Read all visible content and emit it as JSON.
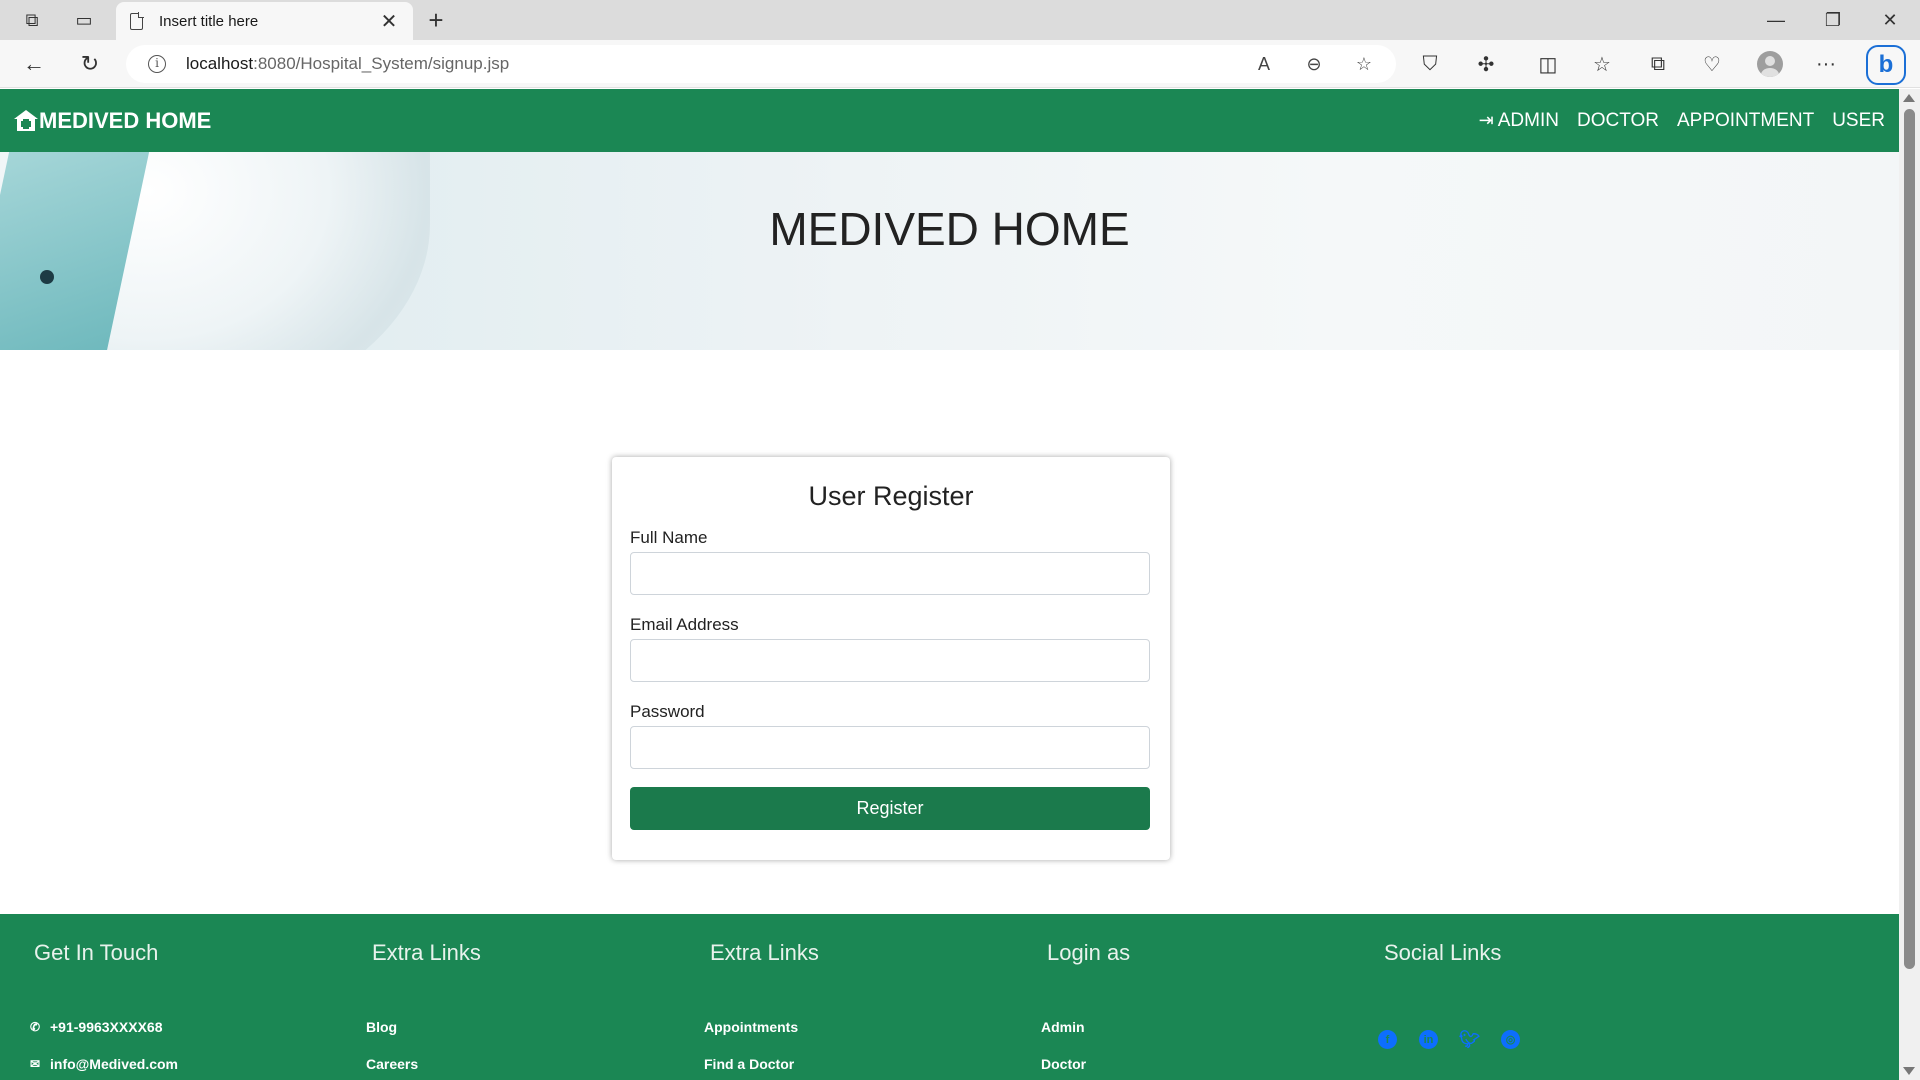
{
  "browser": {
    "tab_title": "Insert title here",
    "url_host": "localhost",
    "url_path": ":8080/Hospital_System/signup.jsp"
  },
  "navbar": {
    "brand": "MEDIVED HOME",
    "links": [
      "ADMIN",
      "DOCTOR",
      "APPOINTMENT",
      "USER"
    ]
  },
  "hero": {
    "title": "MEDIVED HOME"
  },
  "form": {
    "title": "User Register",
    "full_name_label": "Full Name",
    "full_name_value": "",
    "email_label": "Email Address",
    "email_value": "",
    "password_label": "Password",
    "password_value": "",
    "submit_label": "Register"
  },
  "footer": {
    "get_in_touch": {
      "heading": "Get In Touch",
      "phone": "+91-9963XXXX68",
      "email": "info@Medived.com"
    },
    "extra_links_1": {
      "heading": "Extra Links",
      "items": [
        "Blog",
        "Careers"
      ]
    },
    "extra_links_2": {
      "heading": "Extra Links",
      "items": [
        "Appointments",
        "Find a Doctor"
      ]
    },
    "login_as": {
      "heading": "Login as",
      "items": [
        "Admin",
        "Doctor"
      ]
    },
    "social": {
      "heading": "Social Links",
      "icons": [
        "facebook-icon",
        "linkedin-icon",
        "twitter-icon",
        "globe-icon"
      ]
    }
  },
  "colors": {
    "brand_green": "#1b8754",
    "button_green": "#1b7a4c",
    "social_blue": "#0d6efd"
  }
}
